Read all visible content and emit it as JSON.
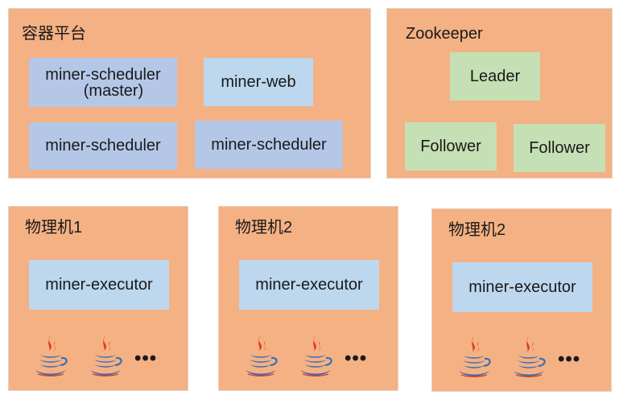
{
  "container_platform": {
    "title": "容器平台",
    "scheduler_master_line1": "miner-scheduler",
    "scheduler_master_line2": "(master)",
    "web": "miner-web",
    "scheduler_2": "miner-scheduler",
    "scheduler_3": "miner-scheduler"
  },
  "zookeeper": {
    "title": "Zookeeper",
    "leader": "Leader",
    "follower_1": "Follower",
    "follower_2": "Follower"
  },
  "machines": [
    {
      "title": "物理机1",
      "executor": "miner-executor",
      "more": "•••"
    },
    {
      "title": "物理机2",
      "executor": "miner-executor",
      "more": "•••"
    },
    {
      "title": "物理机2",
      "executor": "miner-executor",
      "more": "•••"
    }
  ],
  "icons": {
    "process": "java-icon"
  },
  "colors": {
    "panel": "#f4b183",
    "scheduler_box": "#b4c7e7",
    "web_executor_box": "#bdd7ee",
    "zk_box": "#c5e0b4",
    "java_red": "#e03a1e",
    "java_blue": "#3b6db5"
  }
}
